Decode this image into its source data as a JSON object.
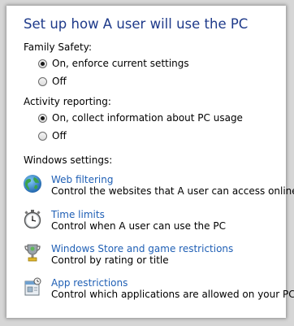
{
  "title": "Set up how A user will use the PC",
  "family_safety": {
    "label": "Family Safety:",
    "options": [
      {
        "label": "On, enforce current settings",
        "selected": true
      },
      {
        "label": "Off",
        "selected": false
      }
    ]
  },
  "activity_reporting": {
    "label": "Activity reporting:",
    "options": [
      {
        "label": "On, collect information about PC usage",
        "selected": true
      },
      {
        "label": "Off",
        "selected": false
      }
    ]
  },
  "windows_settings": {
    "label": "Windows settings:",
    "items": [
      {
        "link": "Web filtering",
        "desc": "Control the websites that A user can access online",
        "icon": "globe-icon"
      },
      {
        "link": "Time limits",
        "desc": "Control when A user can use the PC",
        "icon": "stopwatch-icon"
      },
      {
        "link": "Windows Store and game restrictions",
        "desc": "Control by rating or title",
        "icon": "trophy-icon"
      },
      {
        "link": "App restrictions",
        "desc": "Control which applications are allowed on your PC",
        "icon": "app-restrictions-icon"
      }
    ]
  },
  "colors": {
    "title": "#1e3a8a",
    "link": "#1f5fb5"
  }
}
